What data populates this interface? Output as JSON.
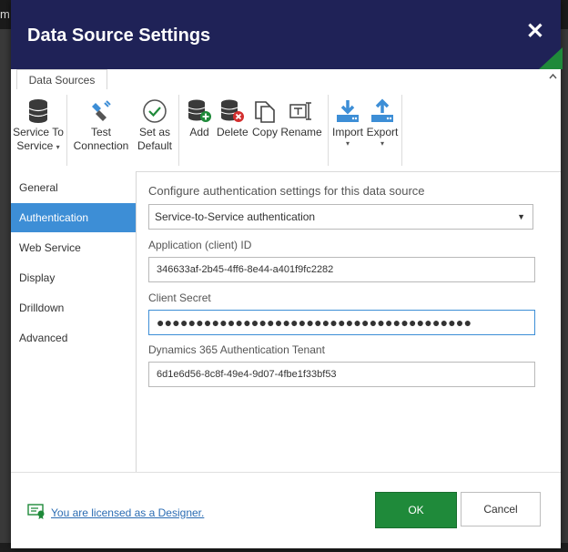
{
  "background": {
    "window_text": "m"
  },
  "dialog": {
    "title": "Data Source Settings",
    "close_glyph": "✕"
  },
  "tabs": [
    {
      "label": "Data Sources"
    }
  ],
  "ribbon": {
    "buttons": [
      {
        "label1": "Service To",
        "label2": "Service",
        "dropdown": "▾",
        "icon": "database-icon"
      },
      {
        "label1": "Test",
        "label2": "Connection",
        "icon": "plug-icon"
      },
      {
        "label1": "Set as",
        "label2": "Default",
        "icon": "checkmark-circle-icon"
      },
      {
        "label1": "Add",
        "icon": "database-add-icon"
      },
      {
        "label1": "Delete",
        "icon": "database-delete-icon"
      },
      {
        "label1": "Copy",
        "icon": "copy-icon"
      },
      {
        "label1": "Rename",
        "icon": "rename-icon"
      },
      {
        "label1": "Import",
        "dropdown": "▾",
        "icon": "download-icon"
      },
      {
        "label1": "Export",
        "dropdown": "▾",
        "icon": "upload-icon"
      }
    ]
  },
  "sidebar": {
    "items": [
      {
        "label": "General"
      },
      {
        "label": "Authentication",
        "active": true
      },
      {
        "label": "Web Service"
      },
      {
        "label": "Display"
      },
      {
        "label": "Drilldown"
      },
      {
        "label": "Advanced"
      }
    ]
  },
  "auth": {
    "heading": "Configure authentication settings for this data source",
    "method": "Service-to-Service authentication",
    "app_id_label": "Application (client) ID",
    "app_id_value": "346633af-2b45-4ff6-8e44-a401f9fc2282",
    "secret_label": "Client Secret",
    "secret_value": "●●●●●●●●●●●●●●●●●●●●●●●●●●●●●●●●●●●●●●●●",
    "tenant_label": "Dynamics 365 Authentication Tenant",
    "tenant_value": "6d1e6d56-8c8f-49e4-9d07-4fbe1f33bf53"
  },
  "footer": {
    "license_text": "You are licensed as a Designer.",
    "ok_label": "OK",
    "cancel_label": "Cancel"
  },
  "colors": {
    "titlebar": "#1f2257",
    "accent": "#3d8ed6",
    "ok": "#1f8a3a"
  }
}
